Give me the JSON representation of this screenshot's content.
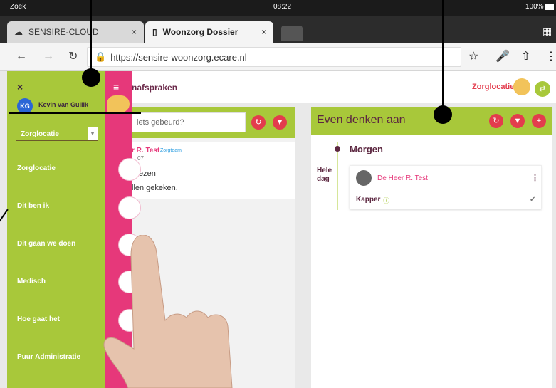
{
  "status": {
    "back_label": "Zoek",
    "time": "08:22",
    "battery": "100%"
  },
  "tabs": [
    {
      "label": "SENSIRE-CLOUD"
    },
    {
      "label": "Woonzorg Dossier"
    }
  ],
  "address": {
    "url": "https://sensire-woonzorg.ecare.nl"
  },
  "sidebar": {
    "user_initials": "KG",
    "user_name": "Kevin van Gullik",
    "select_value": "Zorglocatie",
    "items": [
      {
        "label": "Zorglocatie"
      },
      {
        "label": "Dit ben ik"
      },
      {
        "label": "Dit gaan we doen"
      },
      {
        "label": "Medisch"
      },
      {
        "label": "Hoe gaat het"
      },
      {
        "label": "Puur Administratie"
      }
    ]
  },
  "header": {
    "title_partial": "nafspraken",
    "location": "Zorglocatie"
  },
  "left_panel": {
    "input_placeholder": "iets gebeurd?",
    "post_author": "r R. Test",
    "post_tag": "Zorgteam",
    "post_date": "07",
    "post_line1": "ezen",
    "post_line2": "llen gekeken."
  },
  "right_panel": {
    "title": "Even denken aan",
    "day_label": "Morgen",
    "allday_label": "Hele dag",
    "person": "De Heer R. Test",
    "appointment": "Kapper"
  },
  "colors": {
    "green": "#a8c83a",
    "pink": "#e6387a",
    "red": "#e33c4d"
  }
}
